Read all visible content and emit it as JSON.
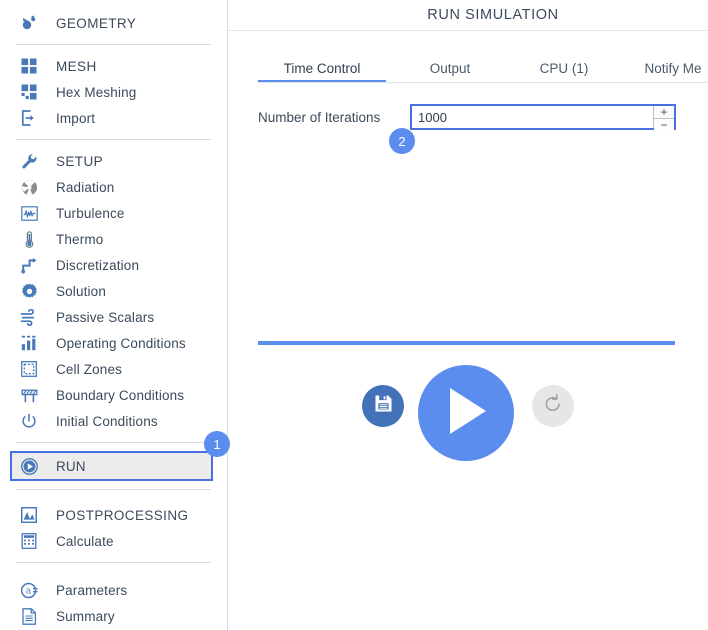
{
  "sidebar": {
    "groups": [
      {
        "items": [
          {
            "label": "GEOMETRY",
            "icon": "geometry-icon",
            "heading": true
          }
        ]
      },
      {
        "items": [
          {
            "label": "MESH",
            "icon": "mesh-icon",
            "heading": true
          },
          {
            "label": "Hex Meshing",
            "icon": "hex-meshing-icon",
            "heading": false
          },
          {
            "label": "Import",
            "icon": "import-icon",
            "heading": false
          }
        ]
      },
      {
        "items": [
          {
            "label": "SETUP",
            "icon": "wrench-icon",
            "heading": true
          },
          {
            "label": "Radiation",
            "icon": "radiation-icon",
            "heading": false
          },
          {
            "label": "Turbulence",
            "icon": "turbulence-icon",
            "heading": false
          },
          {
            "label": "Thermo",
            "icon": "thermometer-icon",
            "heading": false
          },
          {
            "label": "Discretization",
            "icon": "discretization-icon",
            "heading": false
          },
          {
            "label": "Solution",
            "icon": "gear-icon",
            "heading": false
          },
          {
            "label": "Passive Scalars",
            "icon": "wind-icon",
            "heading": false
          },
          {
            "label": "Operating Conditions",
            "icon": "bar-chart-icon",
            "heading": false
          },
          {
            "label": "Cell Zones",
            "icon": "cell-zones-icon",
            "heading": false
          },
          {
            "label": "Boundary Conditions",
            "icon": "boundary-conditions-icon",
            "heading": false
          },
          {
            "label": "Initial Conditions",
            "icon": "power-icon",
            "heading": false
          }
        ]
      },
      {
        "items": [
          {
            "label": "RUN",
            "icon": "play-circle-icon",
            "heading": false,
            "selected": true
          }
        ]
      },
      {
        "items": [
          {
            "label": "POSTPROCESSING",
            "icon": "postprocessing-icon",
            "heading": true
          },
          {
            "label": "Calculate",
            "icon": "calculator-icon",
            "heading": false
          }
        ]
      },
      {
        "items": [
          {
            "label": "Parameters",
            "icon": "parameters-icon",
            "heading": false
          },
          {
            "label": "Summary",
            "icon": "document-icon",
            "heading": false
          }
        ]
      }
    ]
  },
  "main": {
    "title": "RUN SIMULATION",
    "tabs": [
      {
        "label": "Time Control",
        "active": true
      },
      {
        "label": "Output",
        "active": false
      },
      {
        "label": "CPU  (1)",
        "active": false
      },
      {
        "label": "Notify Me",
        "active": false
      }
    ],
    "field": {
      "label": "Number of Iterations",
      "value": "1000",
      "placeholder": "1000",
      "increment_label": "+",
      "decrement_label": "−"
    },
    "actions": {
      "save_label": "save-button",
      "run_label": "run-button",
      "reset_label": "reset-button"
    }
  },
  "badges": [
    {
      "id": "badge-1",
      "text": "1"
    },
    {
      "id": "badge-2",
      "text": "2"
    }
  ],
  "colors": {
    "accent": "#5b8def",
    "accent_dark": "#4472b8",
    "selection_border": "#4a6fe3",
    "icon_blue": "#4a79b8",
    "reset_gray": "#e6e6e6",
    "text": "#3b4a5c"
  }
}
